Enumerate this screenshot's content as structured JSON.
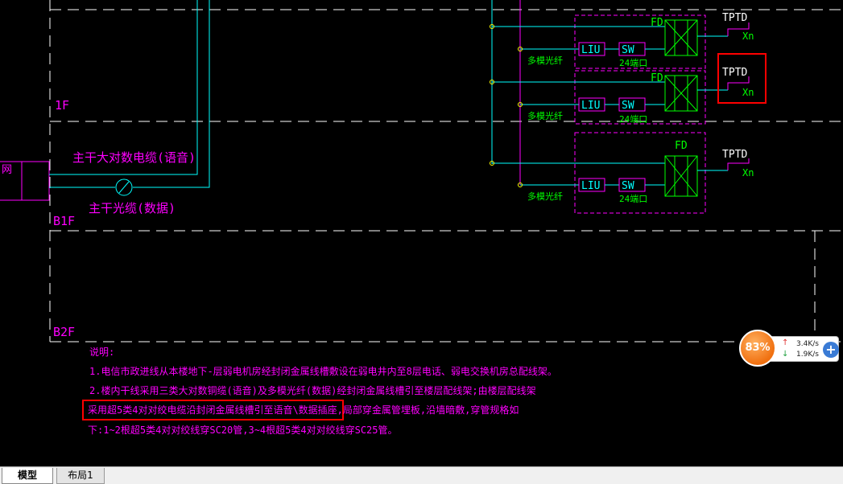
{
  "floors": {
    "f1": "1F",
    "b1f": "B1F",
    "b2f": "B2F"
  },
  "labels": {
    "left_edge": "网",
    "trunk_copper": "主干大对数电缆(语音)",
    "trunk_fiber": "主干光缆(数据)",
    "multimode_fiber": "多模光纤",
    "fd": "FD",
    "liu": "LIU",
    "sw": "SW",
    "ports_24": "24端口",
    "tp_td": "TPTD",
    "xn": "Xn"
  },
  "notes": {
    "heading": "说明:",
    "line1": "1.电信市政进线从本楼地下-层弱电机房经封闭金属线槽敷设在弱电井内至8层电话、弱电交换机房总配线架。",
    "line2": "2.楼内干线采用三类大对数铜缆(语音)及多模光纤(数据)经封闭金属线槽引至楼层配线架;由楼层配线架",
    "line3": "采用超5类4对对绞电缆沿封闭金属线槽引至语音\\数据插座,局部穿金属管埋板,沿墙暗敷,穿管规格如",
    "line4": "下:1~2根超5类4对对绞线穿SC20管,3~4根超5类4对对绞线穿SC25管。"
  },
  "tabs": {
    "model": "模型",
    "layout1": "布局1"
  },
  "speed_widget": {
    "percent": "83%",
    "upload": "3.4K/s",
    "download": "1.9K/s"
  },
  "colors": {
    "magenta": "#ff00ff",
    "cyan": "#00ffff",
    "green": "#00ff00",
    "white": "#ffffff",
    "yellow": "#ffff00",
    "highlight": "#ff0000"
  }
}
